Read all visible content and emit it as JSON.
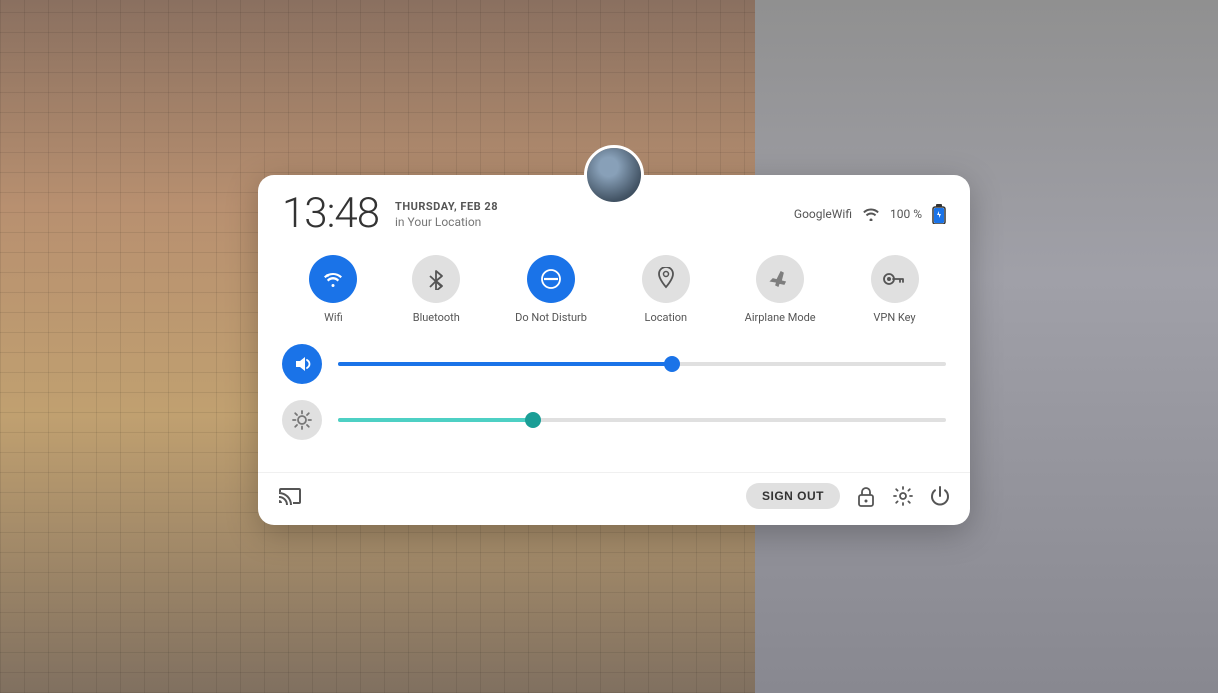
{
  "background": {
    "description": "City building photograph background"
  },
  "panel": {
    "time": "13:48",
    "date": "THURSDAY, FEB 28",
    "location": "in Your Location",
    "wifi_name": "GoogleWifi",
    "battery_pct": "100 %",
    "avatar_alt": "User avatar"
  },
  "toggles": [
    {
      "id": "wifi",
      "label": "Wifi",
      "active": true
    },
    {
      "id": "bluetooth",
      "label": "Bluetooth",
      "active": false
    },
    {
      "id": "do-not-disturb",
      "label": "Do Not Disturb",
      "active": true
    },
    {
      "id": "location",
      "label": "Location",
      "active": false
    },
    {
      "id": "airplane-mode",
      "label": "Airplane Mode",
      "active": false
    },
    {
      "id": "vpn-key",
      "label": "VPN Key",
      "active": false
    }
  ],
  "sliders": [
    {
      "id": "volume",
      "label": "Volume",
      "value": 55,
      "active": true
    },
    {
      "id": "brightness",
      "label": "Brightness",
      "value": 32,
      "active": false
    }
  ],
  "footer": {
    "cast_label": "Cast",
    "sign_out_label": "SIGN OUT",
    "lock_label": "Lock",
    "settings_label": "Settings",
    "power_label": "Power"
  },
  "colors": {
    "active_blue": "#1a73e8",
    "inactive_gray": "#e0e0e0",
    "text_dark": "#333",
    "text_mid": "#555",
    "text_light": "#777"
  }
}
